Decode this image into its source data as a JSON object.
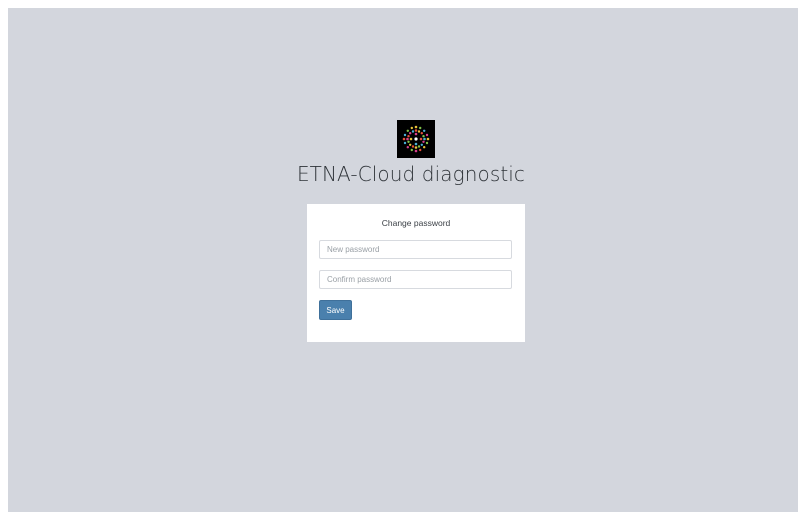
{
  "app": {
    "title": "ETNA-Cloud diagnostic",
    "logo_icon": "etna-burst-logo-icon"
  },
  "form": {
    "title": "Change password",
    "new_password": {
      "value": "",
      "placeholder": "New password"
    },
    "confirm_password": {
      "value": "",
      "placeholder": "Confirm password"
    },
    "save_label": "Save"
  },
  "colors": {
    "background": "#d3d6dd",
    "card": "#ffffff",
    "button": "#4a80ad",
    "title_text": "#2e3338"
  }
}
